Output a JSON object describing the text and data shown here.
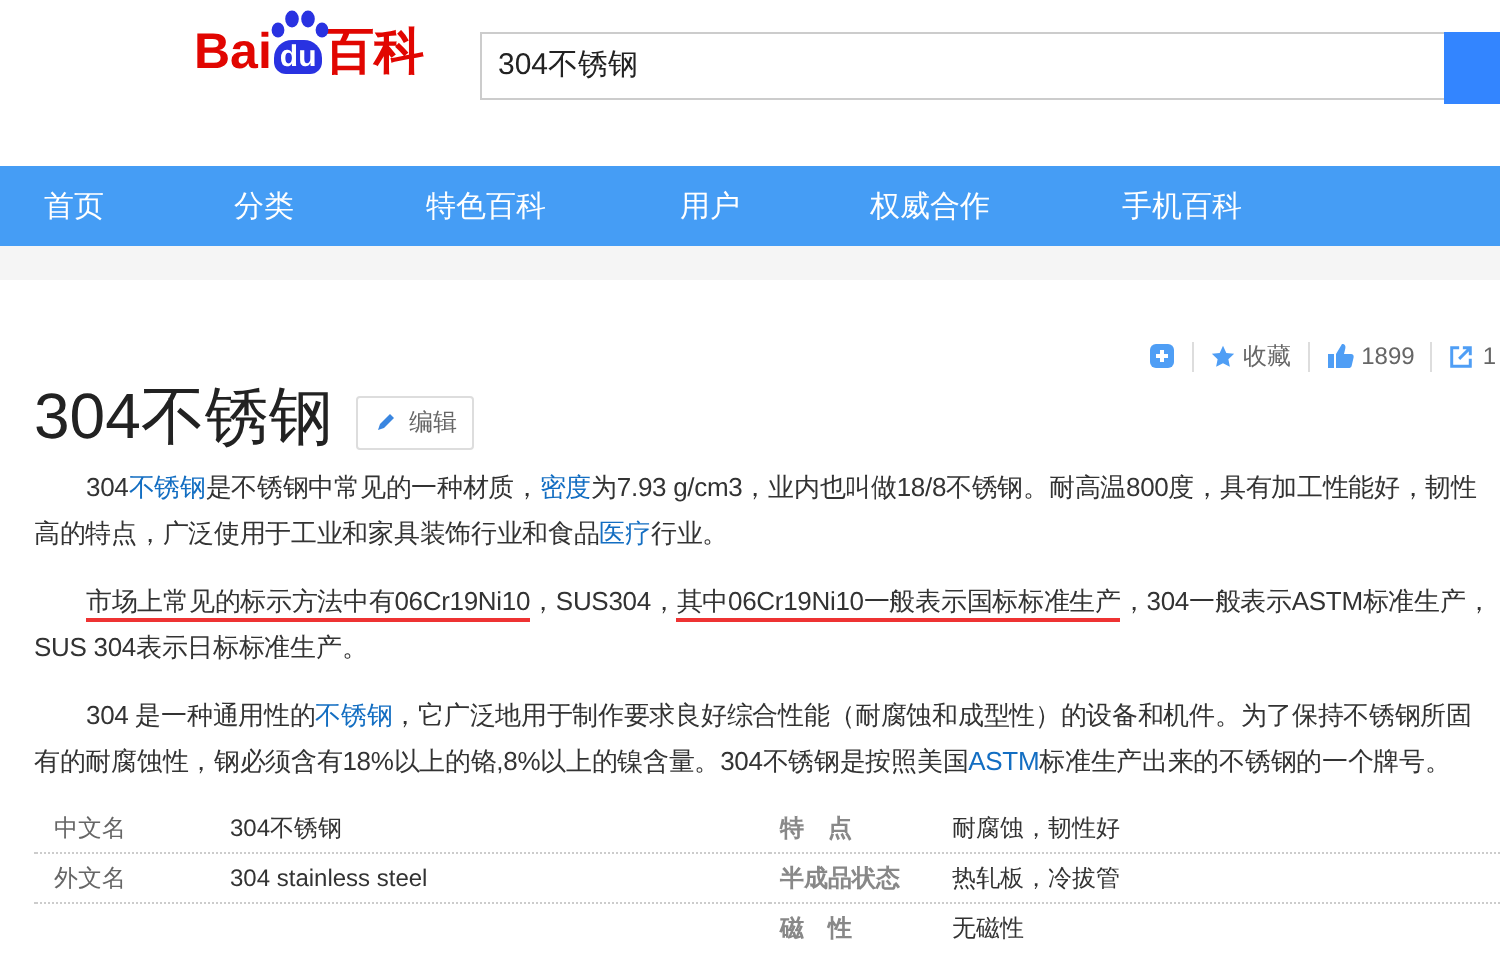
{
  "logo": {
    "left": "Bai",
    "mark": "du",
    "right": "百科"
  },
  "search": {
    "value": "304不锈钢"
  },
  "nav": [
    "首页",
    "分类",
    "特色百科",
    "用户",
    "权威合作",
    "手机百科"
  ],
  "toolbar": {
    "favorite": "收藏",
    "likes": "1899",
    "shares": "1"
  },
  "title": "304不锈钢",
  "edit_button": "编辑",
  "paragraphs": [
    [
      {
        "kind": "text",
        "text": "304"
      },
      {
        "kind": "link",
        "text": "不锈钢"
      },
      {
        "kind": "text",
        "text": "是不锈钢中常见的一种材质，"
      },
      {
        "kind": "link",
        "text": "密度"
      },
      {
        "kind": "text",
        "text": "为7.93 g/cm3，业内也叫做18/8不锈钢。耐高温800度，具有加工性能好，韧性高的特点，广泛使用于工业和家具装饰行业和食品"
      },
      {
        "kind": "link",
        "text": "医疗"
      },
      {
        "kind": "text",
        "text": "行业。"
      }
    ],
    [
      {
        "kind": "underlined",
        "text": "市场上常见的标示方法中有06Cr19Ni10"
      },
      {
        "kind": "text",
        "text": "，SUS304，"
      },
      {
        "kind": "underlined",
        "text": "其中06Cr19Ni10一般表示国标标准生产"
      },
      {
        "kind": "text",
        "text": "，304一般表示ASTM标准生产，SUS 304表示日标标准生产。"
      }
    ],
    [
      {
        "kind": "text",
        "text": "304 是一种通用性的"
      },
      {
        "kind": "link",
        "text": "不锈钢"
      },
      {
        "kind": "text",
        "text": "，它广泛地用于制作要求良好综合性能（耐腐蚀和成型性）的设备和机件。为了保持不锈钢所固有的耐腐蚀性，钢必须含有18%以上的铬,8%以上的镍含量。304不锈钢是按照美国"
      },
      {
        "kind": "link",
        "text": "ASTM"
      },
      {
        "kind": "text",
        "text": "标准生产出来的不锈钢的一个牌号。"
      }
    ]
  ],
  "basic_info": {
    "left": [
      {
        "label": "中文名",
        "value": "304不锈钢"
      },
      {
        "label": "外文名",
        "value": "304 stainless steel"
      }
    ],
    "right": [
      {
        "label": "特　点",
        "value": "耐腐蚀，韧性好"
      },
      {
        "label": "半成品状态",
        "value": "热轧板，冷拔管"
      },
      {
        "label": "磁　性",
        "value": "无磁性"
      }
    ]
  }
}
